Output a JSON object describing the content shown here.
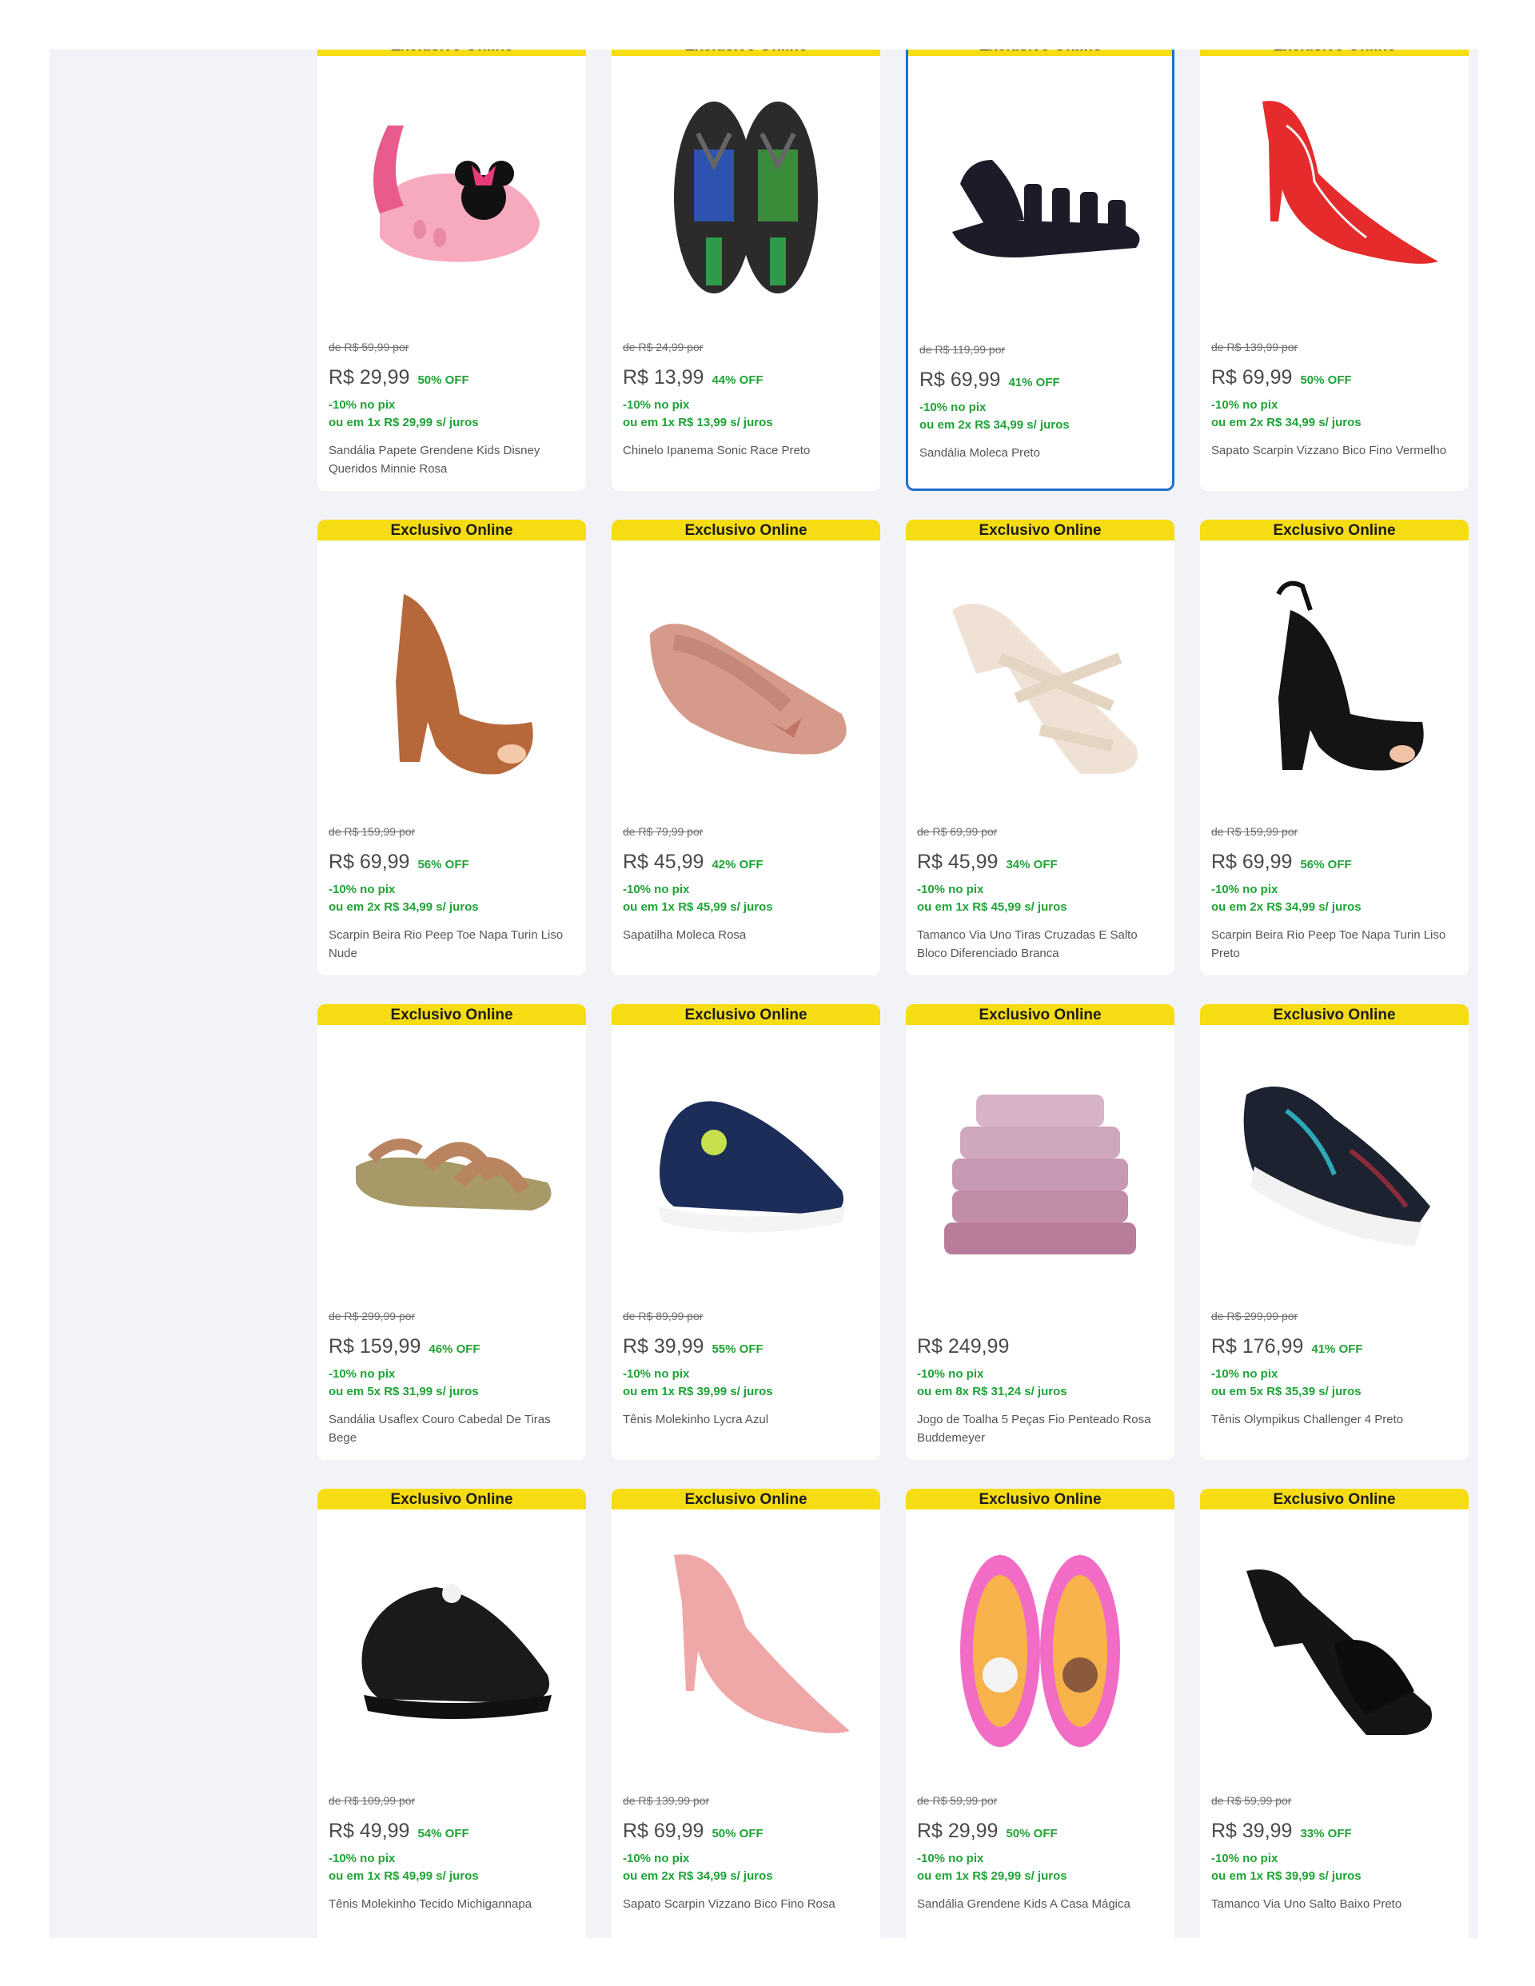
{
  "products": [
    {
      "badge": "Exclusivo Online",
      "old_price": "de R$ 59,99 por",
      "price": "R$ 29,99",
      "discount": "50% OFF",
      "pix": "-10% no pix",
      "installment": "ou em 1x R$ 29,99 s/ juros",
      "title": "Sandália Papete Grendene Kids Disney Queridos Minnie Rosa",
      "icon": "minnie-sandal-icon"
    },
    {
      "badge": "Exclusivo Online",
      "old_price": "de R$ 24,99 por",
      "price": "R$ 13,99",
      "discount": "44% OFF",
      "pix": "-10% no pix",
      "installment": "ou em 1x R$ 13,99 s/ juros",
      "title": "Chinelo Ipanema Sonic Race Preto",
      "icon": "flip-flop-icon"
    },
    {
      "badge": "Exclusivo Online",
      "old_price": "de R$ 119,99 por",
      "price": "R$ 69,99",
      "discount": "41% OFF",
      "pix": "-10% no pix",
      "installment": "ou em 2x R$ 34,99 s/ juros",
      "title": "Sandália Moleca Preto",
      "icon": "strappy-sandal-icon",
      "selected": true
    },
    {
      "badge": "Exclusivo Online",
      "old_price": "de R$ 139,99 por",
      "price": "R$ 69,99",
      "discount": "50% OFF",
      "pix": "-10% no pix",
      "installment": "ou em 2x R$ 34,99 s/ juros",
      "title": "Sapato Scarpin Vizzano Bico Fino Vermelho",
      "icon": "pump-shoe-icon"
    },
    {
      "badge": "Exclusivo Online",
      "old_price": "de R$ 159,99 por",
      "price": "R$ 69,99",
      "discount": "56% OFF",
      "pix": "-10% no pix",
      "installment": "ou em 2x R$ 34,99 s/ juros",
      "title": "Scarpin Beira Rio Peep Toe Napa Turin Liso Nude",
      "icon": "peep-toe-icon"
    },
    {
      "badge": "Exclusivo Online",
      "old_price": "de R$ 79,99 por",
      "price": "R$ 45,99",
      "discount": "42% OFF",
      "pix": "-10% no pix",
      "installment": "ou em 1x R$ 45,99 s/ juros",
      "title": "Sapatilha Moleca Rosa",
      "icon": "ballet-flat-icon"
    },
    {
      "badge": "Exclusivo Online",
      "old_price": "de R$ 69,99 por",
      "price": "R$ 45,99",
      "discount": "34% OFF",
      "pix": "-10% no pix",
      "installment": "ou em 1x R$ 45,99 s/ juros",
      "title": "Tamanco Via Uno Tiras Cruzadas E Salto Bloco Diferenciado Branca",
      "icon": "mule-sandal-icon"
    },
    {
      "badge": "Exclusivo Online",
      "old_price": "de R$ 159,99 por",
      "price": "R$ 69,99",
      "discount": "56% OFF",
      "pix": "-10% no pix",
      "installment": "ou em 2x R$ 34,99 s/ juros",
      "title": "Scarpin Beira Rio Peep Toe Napa Turin Liso Preto",
      "icon": "slingback-icon"
    },
    {
      "badge": "Exclusivo Online",
      "old_price": "de R$ 299,99 por",
      "price": "R$ 159,99",
      "discount": "46% OFF",
      "pix": "-10% no pix",
      "installment": "ou em 5x R$ 31,99 s/ juros",
      "title": "Sandália Usaflex Couro Cabedal De Tiras Bege",
      "icon": "flat-sandal-icon"
    },
    {
      "badge": "Exclusivo Online",
      "old_price": "de R$ 89,99 por",
      "price": "R$ 39,99",
      "discount": "55% OFF",
      "pix": "-10% no pix",
      "installment": "ou em 1x R$ 39,99 s/ juros",
      "title": "Tênis Molekinho Lycra Azul",
      "icon": "kids-sneaker-icon"
    },
    {
      "badge": "Exclusivo Online",
      "old_price": "",
      "price": "R$ 249,99",
      "discount": "",
      "pix": "-10% no pix",
      "installment": "ou em 8x R$ 31,24 s/ juros",
      "title": "Jogo de Toalha 5 Peças Fio Penteado Rosa Buddemeyer",
      "icon": "towel-stack-icon"
    },
    {
      "badge": "Exclusivo Online",
      "old_price": "de R$ 299,99 por",
      "price": "R$ 176,99",
      "discount": "41% OFF",
      "pix": "-10% no pix",
      "installment": "ou em 5x R$ 35,39 s/ juros",
      "title": "Tênis Olympikus Challenger 4 Preto",
      "icon": "running-shoe-icon"
    },
    {
      "badge": "Exclusivo Online",
      "old_price": "de R$ 109,99 por",
      "price": "R$ 49,99",
      "discount": "54% OFF",
      "pix": "-10% no pix",
      "installment": "ou em 1x R$ 49,99 s/ juros",
      "title": "Tênis Molekinho Tecido Michigannapa",
      "icon": "black-sneaker-icon"
    },
    {
      "badge": "Exclusivo Online",
      "old_price": "de R$ 139,99 por",
      "price": "R$ 69,99",
      "discount": "50% OFF",
      "pix": "-10% no pix",
      "installment": "ou em 2x R$ 34,99 s/ juros",
      "title": "Sapato Scarpin Vizzano Bico Fino Rosa",
      "icon": "pink-pump-icon"
    },
    {
      "badge": "Exclusivo Online",
      "old_price": "de R$ 59,99 por",
      "price": "R$ 29,99",
      "discount": "50% OFF",
      "pix": "-10% no pix",
      "installment": "ou em 1x R$ 29,99 s/ juros",
      "title": "Sandália Grendene Kids A Casa Mágica",
      "icon": "kids-jelly-sandal-icon"
    },
    {
      "badge": "Exclusivo Online",
      "old_price": "de R$ 59,99 por",
      "price": "R$ 39,99",
      "discount": "33% OFF",
      "pix": "-10% no pix",
      "installment": "ou em 1x R$ 39,99 s/ juros",
      "title": "Tamanco Via Uno Salto Baixo Preto",
      "icon": "block-mule-icon"
    }
  ],
  "colors": {
    "badge_bg": "#f6dc13",
    "discount_green": "#1fa336",
    "selected_border": "#1f6fd1",
    "page_bg": "#f1f3f6"
  }
}
